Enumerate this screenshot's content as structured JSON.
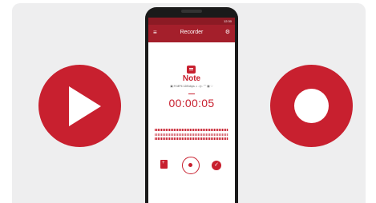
{
  "status_bar": {
    "time": "12:30"
  },
  "app_bar": {
    "menu_icon": "menu-icon",
    "title": "Recorder",
    "settings_icon": "settings-icon"
  },
  "note": {
    "icon": "note-icon",
    "title": "Note",
    "meta": "▣ 🗎 MP4 128 kbps ♫ ◁▷ ⌒ ▦ ♡"
  },
  "timer": "00:00:05",
  "controls": {
    "bookmark_icon": "bookmark-add-icon",
    "record_icon": "record-icon",
    "done_icon": "check-icon",
    "done_glyph": "✓"
  },
  "side_icons": {
    "left": "play-icon",
    "right": "record-icon"
  },
  "colors": {
    "accent": "#c8202f",
    "appbar": "#a41f2b",
    "statusbar": "#8c1a24",
    "background": "#eeeeef"
  }
}
